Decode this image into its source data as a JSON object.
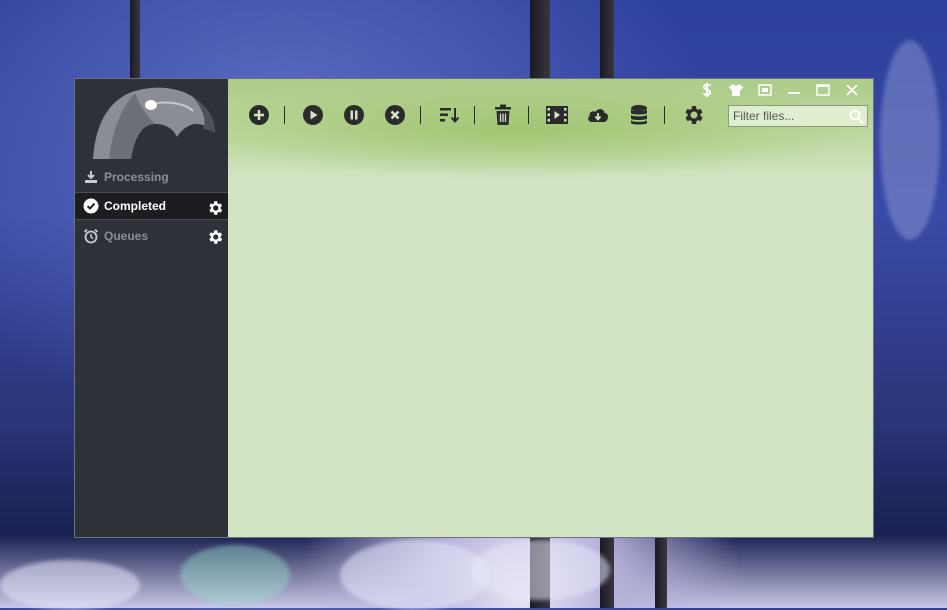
{
  "window": {
    "controls": [
      "dollar-icon",
      "tshirt-icon",
      "compact-mode-icon",
      "minimize-icon",
      "maximize-icon",
      "close-icon"
    ]
  },
  "sidebar": {
    "items": [
      {
        "label": "Processing",
        "icon": "download-tray-icon",
        "active": false,
        "has_settings": false
      },
      {
        "label": "Completed",
        "icon": "check-circle-icon",
        "active": true,
        "has_settings": true
      },
      {
        "label": "Queues",
        "icon": "alarm-clock-icon",
        "active": false,
        "has_settings": true
      }
    ]
  },
  "toolbar": {
    "buttons": [
      "add-icon",
      "play-icon",
      "pause-icon",
      "stop-icon",
      "sort-icon",
      "trash-icon",
      "video-icon",
      "cloud-download-icon",
      "database-icon",
      "settings-icon"
    ]
  },
  "search": {
    "placeholder": "Filter files...",
    "value": ""
  },
  "colors": {
    "sidebar_bg": "#2e3238",
    "main_bg": "#d3e4c4",
    "active_item_bg": "#1b1d21",
    "icon_dark": "#2b2b2b"
  }
}
